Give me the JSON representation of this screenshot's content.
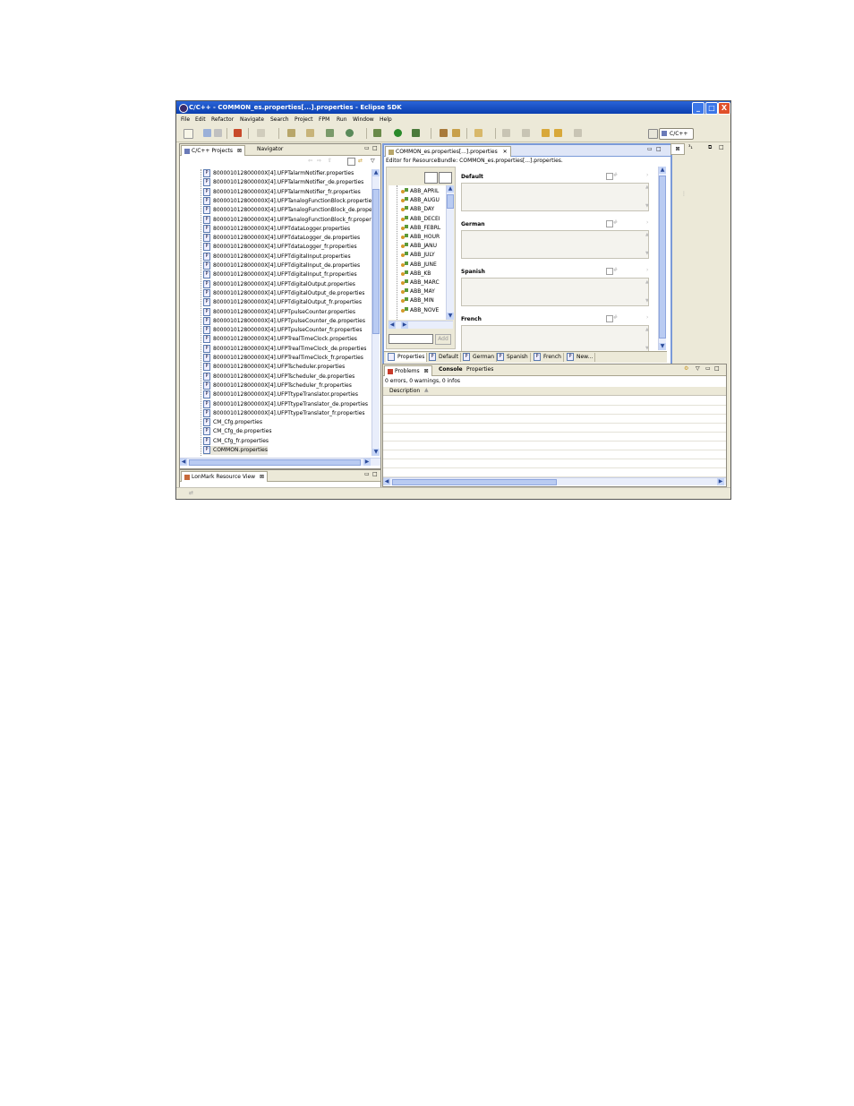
{
  "window": {
    "title": "C/C++ - COMMON_es.properties[...].properties - Eclipse SDK",
    "controls": [
      "_",
      "□",
      "X"
    ]
  },
  "menubar": [
    "File",
    "Edit",
    "Refactor",
    "Navigate",
    "Search",
    "Project",
    "FPM",
    "Run",
    "Window",
    "Help"
  ],
  "perspective": {
    "label": "C/C++"
  },
  "left_panel": {
    "tabs": [
      "C/C++ Projects",
      "Navigator"
    ],
    "files": [
      "800001012800000X[4].UFPTalarmNotifier.properties",
      "800001012800000X[4].UFPTalarmNotifier_de.properties",
      "800001012800000X[4].UFPTalarmNotifier_fr.properties",
      "800001012800000X[4].UFPTanalogFunctionBlock.properties",
      "800001012800000X[4].UFPTanalogFunctionBlock_de.proper",
      "800001012800000X[4].UFPTanalogFunctionBlock_fr.propert",
      "800001012800000X[4].UFPTdataLogger.properties",
      "800001012800000X[4].UFPTdataLogger_de.properties",
      "800001012800000X[4].UFPTdataLogger_fr.properties",
      "800001012800000X[4].UFPTdigitalInput.properties",
      "800001012800000X[4].UFPTdigitalInput_de.properties",
      "800001012800000X[4].UFPTdigitalInput_fr.properties",
      "800001012800000X[4].UFPTdigitalOutput.properties",
      "800001012800000X[4].UFPTdigitalOutput_de.properties",
      "800001012800000X[4].UFPTdigitalOutput_fr.properties",
      "800001012800000X[4].UFPTpulseCounter.properties",
      "800001012800000X[4].UFPTpulseCounter_de.properties",
      "800001012800000X[4].UFPTpulseCounter_fr.properties",
      "800001012800000X[4].UFPTrealTimeClock.properties",
      "800001012800000X[4].UFPTrealTimeClock_de.properties",
      "800001012800000X[4].UFPTrealTimeClock_fr.properties",
      "800001012800000X[4].UFPTscheduler.properties",
      "800001012800000X[4].UFPTscheduler_de.properties",
      "800001012800000X[4].UFPTscheduler_fr.properties",
      "800001012800000X[4].UFPTtypeTranslator.properties",
      "800001012800000X[4].UFPTtypeTranslator_de.properties",
      "800001012800000X[4].UFPTtypeTranslator_fr.properties",
      "CM_Cfg.properties",
      "CM_Cfg_de.properties",
      "CM_Cfg_fr.properties",
      "COMMON.properties"
    ],
    "bottom_view": "LonMark Resource View"
  },
  "editor": {
    "tab": "COMMON_es.properties[...].properties",
    "header": "Editor for ResourceBundle: COMMON_es.properties[...].properties.",
    "keys": [
      "ABB_APRIL",
      "ABB_AUGU",
      "ABB_DAY",
      "ABB_DECEI",
      "ABB_FEBRL",
      "ABB_HOUR",
      "ABB_JANU",
      "ABB_JULY",
      "ABB_JUNE",
      "ABB_KB",
      "ABB_MARC",
      "ABB_MAY",
      "ABB_MIN",
      "ABB_NOVE"
    ],
    "add_button": "Add",
    "sections": [
      "Default",
      "German",
      "Spanish",
      "French"
    ],
    "bottom_tabs": [
      "Properties",
      "Default",
      "German",
      "Spanish",
      "French",
      "New..."
    ]
  },
  "problems": {
    "tabs": [
      "Problems",
      "Console",
      "Properties"
    ],
    "summary": "0 errors, 0 warnings, 0 infos",
    "column": "Description"
  },
  "outline": {
    "tab": "³₁"
  }
}
